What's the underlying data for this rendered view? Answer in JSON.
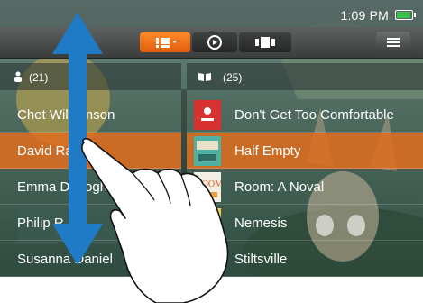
{
  "status": {
    "time": "1:09 PM"
  },
  "toolbar": {
    "buttons": [
      "list-view",
      "now-playing",
      "cover-flow"
    ],
    "active": "list-view",
    "menu_icon": "hamburger-menu-icon"
  },
  "authors": {
    "count": "(21)",
    "items": [
      "Chet Williamson",
      "David Ra",
      "Emma Donoghue",
      "Philip R",
      "Susanna Daniel"
    ],
    "selected_index": 1
  },
  "books": {
    "count": "(25)",
    "items": [
      "Don't Get Too Comfortable",
      "Half Empty",
      "Room: A Noval",
      "Nemesis",
      "Stiltsville"
    ],
    "selected_index": 1
  },
  "colors": {
    "accent": "#e26a1c",
    "arrow": "#1f7bc6",
    "battery": "#39c24a"
  },
  "icons": [
    "person-icon",
    "open-book-icon",
    "list-view-icon",
    "play-circle-icon",
    "cover-flow-icon",
    "hamburger-menu-icon",
    "vertical-scroll-arrow-icon",
    "pointing-hand-icon",
    "battery-icon"
  ]
}
